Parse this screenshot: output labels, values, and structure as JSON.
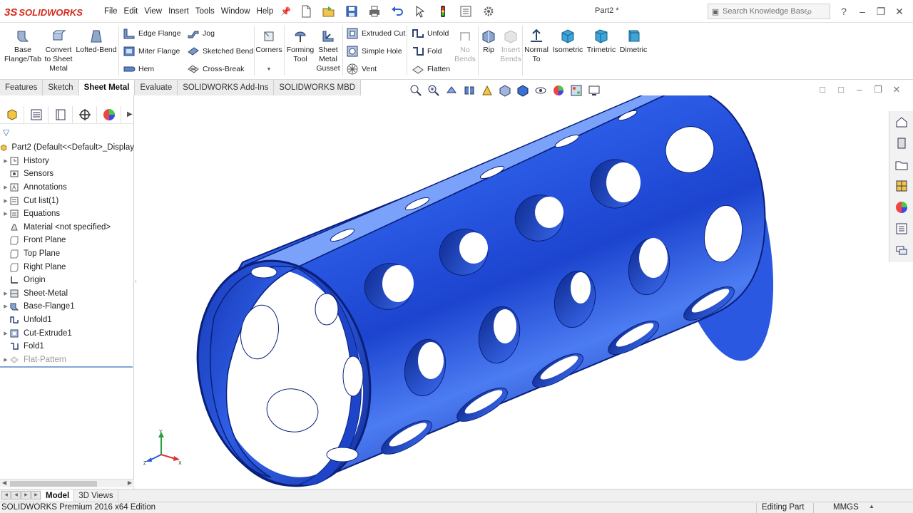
{
  "app": {
    "logo_mark": "3S",
    "logo_text": "SOLIDWORKS",
    "document_title": "Part2 *"
  },
  "menu": [
    "File",
    "Edit",
    "View",
    "Insert",
    "Tools",
    "Window",
    "Help"
  ],
  "search": {
    "placeholder": "Search Knowledge Base"
  },
  "ribbon": {
    "base_flange": "Base\nFlange/Tab",
    "convert": "Convert\nto Sheet\nMetal",
    "lofted_bend": "Lofted-Bend",
    "edge_flange": "Edge Flange",
    "miter_flange": "Miter Flange",
    "hem": "Hem",
    "jog": "Jog",
    "sketched_bend": "Sketched Bend",
    "cross_break": "Cross-Break",
    "corners": "Corners",
    "forming_tool": "Forming\nTool",
    "sheet_metal_gusset": "Sheet\nMetal\nGusset",
    "extruded_cut": "Extruded Cut",
    "simple_hole": "Simple Hole",
    "vent": "Vent",
    "unfold": "Unfold",
    "fold": "Fold",
    "flatten": "Flatten",
    "no_bends": "No\nBends",
    "rip": "Rip",
    "insert_bends": "Insert\nBends",
    "normal_to": "Normal\nTo",
    "isometric": "Isometric",
    "trimetric": "Trimetric",
    "dimetric": "Dimetric"
  },
  "tabs": [
    "Features",
    "Sketch",
    "Sheet Metal",
    "Evaluate",
    "SOLIDWORKS Add-Ins",
    "SOLIDWORKS MBD"
  ],
  "active_tab": "Sheet Metal",
  "tree": {
    "root": "Part2  (Default<<Default>_Display",
    "items": [
      "History",
      "Sensors",
      "Annotations",
      "Cut list(1)",
      "Equations",
      "Material <not specified>",
      "Front Plane",
      "Top Plane",
      "Right Plane",
      "Origin",
      "Sheet-Metal",
      "Base-Flange1",
      "Unfold1",
      "Cut-Extrude1",
      "Fold1",
      "Flat-Pattern"
    ]
  },
  "bottom_tabs": [
    "Model",
    "3D Views"
  ],
  "status": {
    "edition": "SOLIDWORKS Premium 2016 x64 Edition",
    "mode": "Editing Part",
    "units": "MMGS"
  },
  "colors": {
    "model_blue": "#1f4fd6",
    "model_edge": "#0a1f7a",
    "logo_red": "#d52b1e",
    "tab_active_bg": "#ffffff"
  },
  "icons": {
    "triad": "xyz-triad-icon",
    "taskpane": [
      "home-icon",
      "resources-icon",
      "file-explorer-icon",
      "view-palette-icon",
      "appearances-icon",
      "custom-properties-icon",
      "forum-icon"
    ]
  }
}
